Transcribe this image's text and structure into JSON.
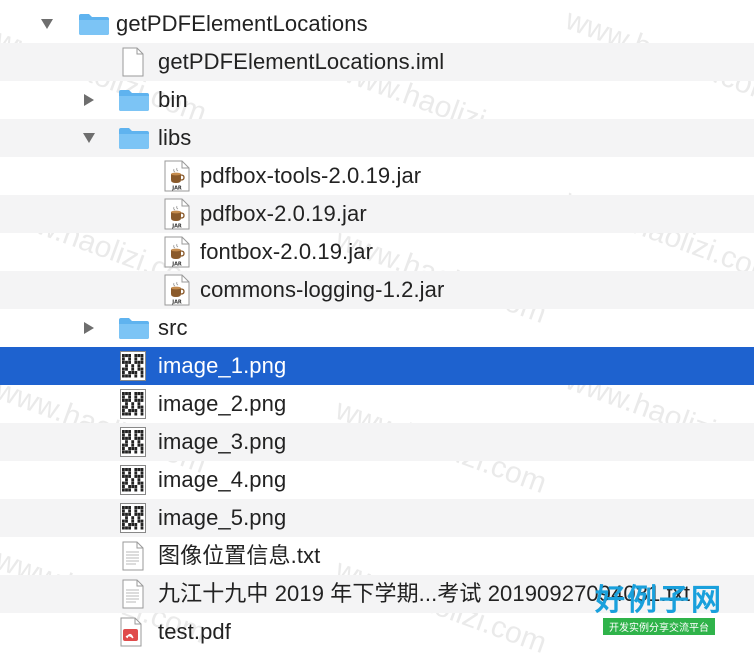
{
  "tree": {
    "rows": [
      {
        "label": "getPDFElementLocations",
        "kind": "folder",
        "disclosure": "open"
      },
      {
        "label": "getPDFElementLocations.iml",
        "kind": "file"
      },
      {
        "label": "bin",
        "kind": "folder",
        "disclosure": "closed"
      },
      {
        "label": "libs",
        "kind": "folder",
        "disclosure": "open"
      },
      {
        "label": "pdfbox-tools-2.0.19.jar",
        "kind": "jar"
      },
      {
        "label": "pdfbox-2.0.19.jar",
        "kind": "jar"
      },
      {
        "label": "fontbox-2.0.19.jar",
        "kind": "jar"
      },
      {
        "label": "commons-logging-1.2.jar",
        "kind": "jar"
      },
      {
        "label": "src",
        "kind": "folder",
        "disclosure": "closed"
      },
      {
        "label": "image_1.png",
        "kind": "image",
        "selected": true
      },
      {
        "label": "image_2.png",
        "kind": "image"
      },
      {
        "label": "image_3.png",
        "kind": "image"
      },
      {
        "label": "image_4.png",
        "kind": "image"
      },
      {
        "label": "image_5.png",
        "kind": "image"
      },
      {
        "label": "图像位置信息.txt",
        "kind": "text"
      },
      {
        "label": "九江十九中 2019 年下学期...考试 20190927094031.txt",
        "kind": "text"
      },
      {
        "label": "test.pdf",
        "kind": "pdf"
      }
    ],
    "jar_badge": "JAR"
  },
  "watermark": {
    "text": "www.haolizi.com",
    "brand_title": "好例子网",
    "brand_subtitle": "开发实例分享交流平台"
  },
  "colors": {
    "selection": "#1e62cf",
    "folder": "#5fb3ef",
    "brand_blue": "#19a0dc",
    "brand_green": "#2fb34a"
  }
}
